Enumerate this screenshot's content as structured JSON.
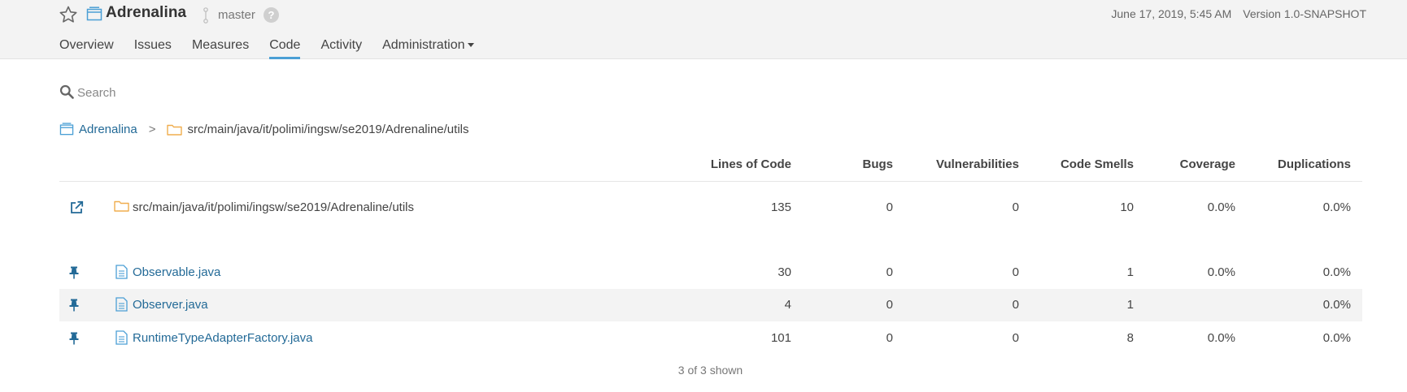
{
  "header": {
    "project_name": "Adrenalina",
    "branch": "master",
    "help": "?",
    "date": "June 17, 2019, 5:45 AM",
    "version": "Version 1.0-SNAPSHOT"
  },
  "nav": {
    "items": [
      {
        "label": "Overview"
      },
      {
        "label": "Issues"
      },
      {
        "label": "Measures"
      },
      {
        "label": "Code",
        "active": true
      },
      {
        "label": "Activity"
      },
      {
        "label": "Administration"
      }
    ]
  },
  "search": {
    "placeholder": "Search"
  },
  "breadcrumb": {
    "project": "Adrenalina",
    "separator": ">",
    "path": "src/main/java/it/polimi/ingsw/se2019/Adrenaline/utils"
  },
  "table": {
    "columns": [
      "Lines of Code",
      "Bugs",
      "Vulnerabilities",
      "Code Smells",
      "Coverage",
      "Duplications"
    ],
    "summary": {
      "name": "src/main/java/it/polimi/ingsw/se2019/Adrenaline/utils",
      "loc": "135",
      "bugs": "0",
      "vulns": "0",
      "smells": "10",
      "coverage": "0.0%",
      "dup": "0.0%"
    },
    "rows": [
      {
        "name": "Observable.java",
        "loc": "30",
        "bugs": "0",
        "vulns": "0",
        "smells": "1",
        "coverage": "0.0%",
        "dup": "0.0%"
      },
      {
        "name": "Observer.java",
        "loc": "4",
        "bugs": "0",
        "vulns": "0",
        "smells": "1",
        "coverage": "",
        "dup": "0.0%"
      },
      {
        "name": "RuntimeTypeAdapterFactory.java",
        "loc": "101",
        "bugs": "0",
        "vulns": "0",
        "smells": "8",
        "coverage": "0.0%",
        "dup": "0.0%"
      }
    ],
    "footer": "3 of 3 shown"
  },
  "colors": {
    "link": "#236a97",
    "accent": "#4b9fd5",
    "folder": "#f0ad4e",
    "header_bg": "#f3f3f3"
  },
  "icons": {
    "favorite": "star-icon",
    "project": "project-icon",
    "branch": "branch-icon",
    "search": "search-icon",
    "folder": "folder-icon",
    "file": "file-icon",
    "open": "external-link-icon",
    "pin": "pin-icon"
  }
}
